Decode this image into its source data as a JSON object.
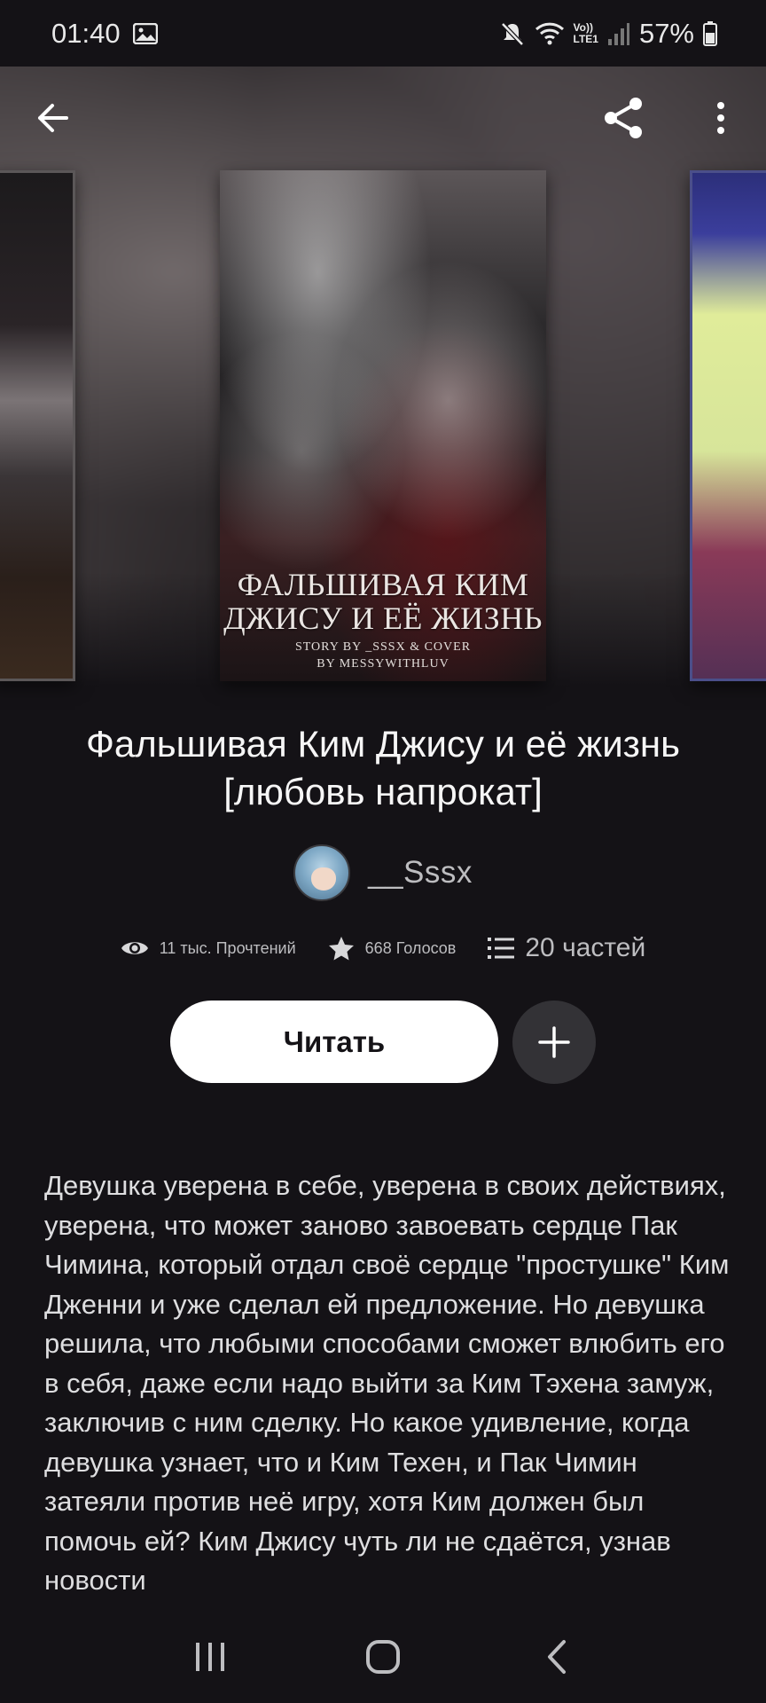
{
  "status_bar": {
    "time": "01:40",
    "battery": "57%",
    "network_label": "LTE1",
    "volte_label": "Vo))"
  },
  "icons": {
    "back": "arrow-left-icon",
    "share": "share-icon",
    "more": "more-vertical-icon",
    "views": "eye-icon",
    "votes": "star-icon",
    "parts": "list-icon",
    "add": "plus-icon"
  },
  "cover": {
    "title": "Фальшивая Ким Джису и её жизнь",
    "credit_line_1": "STORY BY _SSSX & COVER",
    "credit_line_2": "BY MESSYWITHLUV"
  },
  "story": {
    "title": "Фальшивая Ким Джису и её жизнь [любовь напрокат]",
    "author": "__Sssx",
    "reads": "11 тыс. Прочтений",
    "votes": "668 Голосов",
    "parts": "20 частей",
    "read_button": "Читать",
    "description": "Девушка уверена в себе, уверена в своих действиях, уверена, что может заново завоевать сердце Пак Чимина, который отдал своё сердце \"простушке\" Ким Дженни и уже сделал ей предложение. Но девушка решила, что любыми способами сможет влюбить его в себя, даже если надо выйти за Ким Тэхена замуж, заключив с ним сделку. Но какое удивление, когда девушка узнает, что и Ким Техен, и Пак Чимин затеяли против неё игру, хотя Ким должен был помочь ей? Ким Джису чуть ли не сдаётся, узнав новости"
  },
  "colors": {
    "background": "#141216",
    "read_button_bg": "#ffffff",
    "add_button_bg": "#333236",
    "muted_text": "#bdbdc0"
  }
}
